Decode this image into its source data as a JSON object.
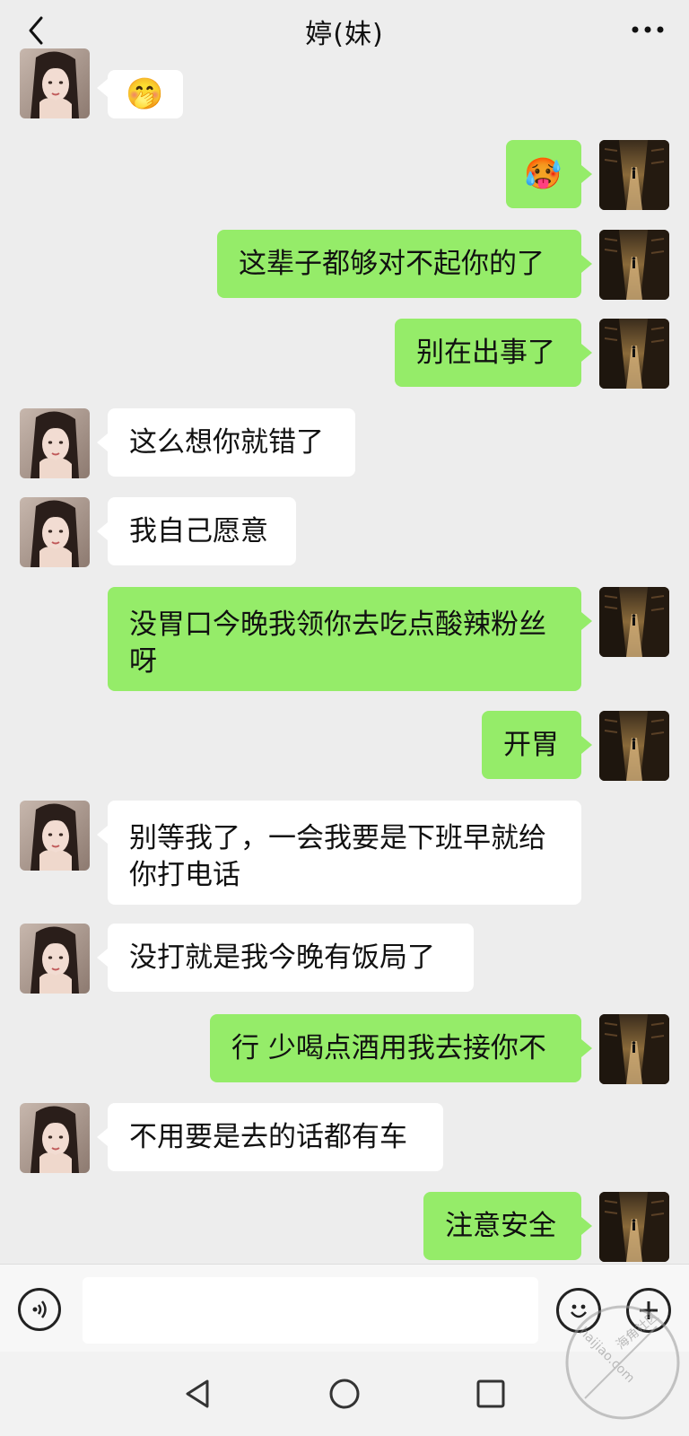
{
  "header": {
    "title": "婷(妹)",
    "back_icon": "chevron-left-icon",
    "more_icon": "more-dots-icon"
  },
  "messages": [
    {
      "side": "left",
      "type": "emoji",
      "text": "🤭"
    },
    {
      "side": "right",
      "type": "emoji",
      "text": "🥵"
    },
    {
      "side": "right",
      "type": "text",
      "text": "这辈子都够对不起你的了"
    },
    {
      "side": "right",
      "type": "text",
      "text": "别在出事了"
    },
    {
      "side": "left",
      "type": "text",
      "text": "这么想你就错了"
    },
    {
      "side": "left",
      "type": "text",
      "text": "我自己愿意"
    },
    {
      "side": "right",
      "type": "text",
      "lines": [
        "没胃口今晚我领你去吃点酸辣粉丝",
        "呀"
      ]
    },
    {
      "side": "right",
      "type": "text",
      "text": "开胃"
    },
    {
      "side": "left",
      "type": "text",
      "lines": [
        "别等我了，一会我要是下班早就给",
        "你打电话"
      ]
    },
    {
      "side": "left",
      "type": "text",
      "text": "没打就是我今晚有饭局了"
    },
    {
      "side": "right",
      "type": "text",
      "text": "行 少喝点酒用我去接你不"
    },
    {
      "side": "left",
      "type": "text",
      "text": "不用要是去的话都有车"
    },
    {
      "side": "right",
      "type": "text",
      "text": "注意安全"
    }
  ],
  "input_bar": {
    "voice_icon": "voice-icon",
    "input_value": "",
    "emoji_icon": "emoji-icon",
    "plus_icon": "plus-icon"
  },
  "nav": {
    "back_icon": "nav-back-icon",
    "home_icon": "nav-home-icon",
    "recent_icon": "nav-recent-icon"
  },
  "watermark": {
    "text_cn": "海角社区",
    "text_en": "haijiao.com"
  },
  "colors": {
    "background": "#ededed",
    "bubble_self": "#95ec69",
    "bubble_other": "#ffffff"
  }
}
